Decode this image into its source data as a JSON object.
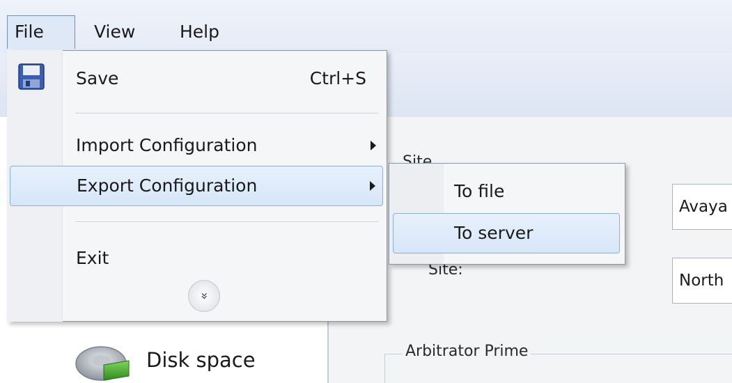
{
  "menubar": {
    "file": "File",
    "view": "View",
    "help": "Help"
  },
  "file_menu": {
    "save_label": "Save",
    "save_shortcut": "Ctrl+S",
    "import_label": "Import Configuration",
    "export_label": "Export Configuration",
    "exit_label": "Exit",
    "expand_glyph": "»"
  },
  "export_submenu": {
    "to_file": "To file",
    "to_server": "To server"
  },
  "content": {
    "site_label_1": "Site",
    "site_label_2": "Site:",
    "site_field_1": "Avaya",
    "site_field_2": "North",
    "arbitrator_label": "Arbitrator Prime"
  },
  "left_panel": {
    "disk_space_label": "Disk space"
  },
  "icons": {
    "save": "save-icon",
    "expand": "expand-icon",
    "submenu_arrow": "chevron-right-icon",
    "disk": "disk-icon"
  },
  "colors": {
    "highlight_bg": "#d6e6f9",
    "highlight_border": "#8ab0e0",
    "menu_bg": "#f5f6f8"
  }
}
